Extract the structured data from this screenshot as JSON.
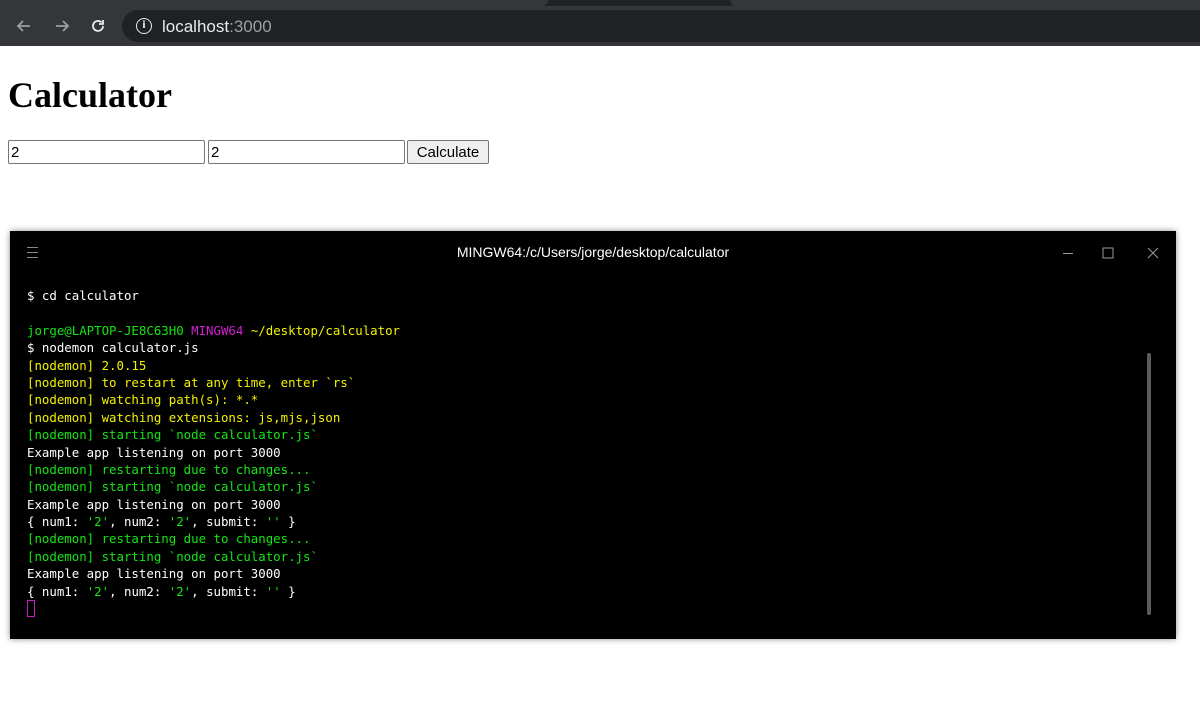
{
  "browser": {
    "url_host": "localhost",
    "url_port": ":3000",
    "icons": {
      "back": "arrow-left-icon",
      "forward": "arrow-right-icon",
      "reload": "reload-icon",
      "info": "info-icon"
    }
  },
  "page": {
    "title": "Calculator",
    "num1_value": "2",
    "num2_value": "2",
    "calculate_label": "Calculate"
  },
  "terminal": {
    "title": "MINGW64:/c/Users/jorge/desktop/calculator",
    "icons": {
      "menu": "hamburger-menu-icon",
      "minimize": "minimize-icon",
      "maximize": "maximize-icon",
      "close": "close-icon"
    },
    "colors": {
      "green": "#14e614",
      "magenta": "#d31dd3",
      "yellow": "#f2f200",
      "white": "#ffffff"
    },
    "lines": [
      {
        "segments": [
          {
            "text": "$ cd calculator",
            "color": "white"
          }
        ]
      },
      {
        "segments": []
      },
      {
        "segments": [
          {
            "text": "jorge@LAPTOP-JE8C63H0 ",
            "color": "green"
          },
          {
            "text": "MINGW64 ",
            "color": "magenta"
          },
          {
            "text": "~/desktop/calculator",
            "color": "yellow"
          }
        ]
      },
      {
        "segments": [
          {
            "text": "$ nodemon calculator.js",
            "color": "white"
          }
        ]
      },
      {
        "segments": [
          {
            "text": "[nodemon] 2.0.15",
            "color": "yellow"
          }
        ]
      },
      {
        "segments": [
          {
            "text": "[nodemon] to restart at any time, enter `rs`",
            "color": "yellow"
          }
        ]
      },
      {
        "segments": [
          {
            "text": "[nodemon] watching path(s): *.*",
            "color": "yellow"
          }
        ]
      },
      {
        "segments": [
          {
            "text": "[nodemon] watching extensions: js,mjs,json",
            "color": "yellow"
          }
        ]
      },
      {
        "segments": [
          {
            "text": "[nodemon] starting `node calculator.js`",
            "color": "green"
          }
        ]
      },
      {
        "segments": [
          {
            "text": "Example app listening on port 3000",
            "color": "white"
          }
        ]
      },
      {
        "segments": [
          {
            "text": "[nodemon] restarting due to changes...",
            "color": "green"
          }
        ]
      },
      {
        "segments": [
          {
            "text": "[nodemon] starting `node calculator.js`",
            "color": "green"
          }
        ]
      },
      {
        "segments": [
          {
            "text": "Example app listening on port 3000",
            "color": "white"
          }
        ]
      },
      {
        "segments": [
          {
            "text": "{ num1: ",
            "color": "white"
          },
          {
            "text": "'2'",
            "color": "green"
          },
          {
            "text": ", num2: ",
            "color": "white"
          },
          {
            "text": "'2'",
            "color": "green"
          },
          {
            "text": ", submit: ",
            "color": "white"
          },
          {
            "text": "''",
            "color": "green"
          },
          {
            "text": " }",
            "color": "white"
          }
        ]
      },
      {
        "segments": [
          {
            "text": "[nodemon] restarting due to changes...",
            "color": "green"
          }
        ]
      },
      {
        "segments": [
          {
            "text": "[nodemon] starting `node calculator.js`",
            "color": "green"
          }
        ]
      },
      {
        "segments": [
          {
            "text": "Example app listening on port 3000",
            "color": "white"
          }
        ]
      },
      {
        "segments": [
          {
            "text": "{ num1: ",
            "color": "white"
          },
          {
            "text": "'2'",
            "color": "green"
          },
          {
            "text": ", num2: ",
            "color": "white"
          },
          {
            "text": "'2'",
            "color": "green"
          },
          {
            "text": ", submit: ",
            "color": "white"
          },
          {
            "text": "''",
            "color": "green"
          },
          {
            "text": " }",
            "color": "white"
          }
        ]
      }
    ]
  }
}
